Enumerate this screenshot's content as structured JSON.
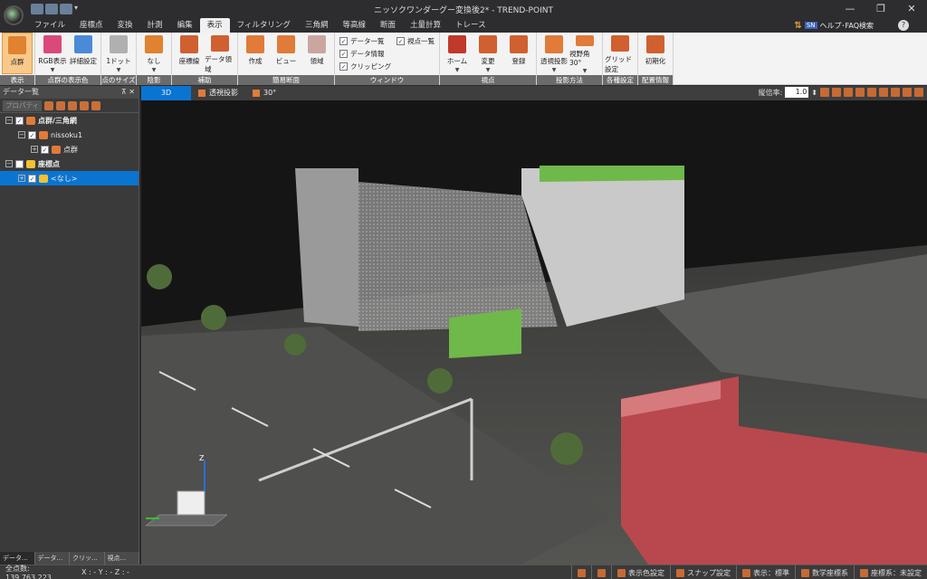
{
  "window": {
    "title": "ニッソクワンダーグー変換後2* - TREND-POINT",
    "minimize": "—",
    "maximize": "❐",
    "close": "✕"
  },
  "menu": {
    "tabs": [
      "ファイル",
      "座標点",
      "変換",
      "計測",
      "編集",
      "表示",
      "フィルタリング",
      "三角網",
      "等高線",
      "断面",
      "土量計算",
      "トレース"
    ],
    "active_index": 5,
    "help_label": "ヘルプ･FAQ検索",
    "help_badge": "SN",
    "help_q": "?"
  },
  "ribbon": {
    "groups": [
      {
        "label": "表示",
        "buttons": [
          {
            "label": "点群",
            "icon_color": "#e0822f",
            "selected": true
          }
        ]
      },
      {
        "label": "点群の表示色",
        "buttons": [
          {
            "label": "RGB表示",
            "icon_color": "#d94a7a",
            "arrow": true
          },
          {
            "label": "詳細設定",
            "icon_color": "#4a8ad6"
          }
        ]
      },
      {
        "label": "点のサイズ",
        "buttons": [
          {
            "label": "1ドット",
            "icon_color": "#b0b0b0",
            "arrow": true
          }
        ]
      },
      {
        "label": "陰影",
        "buttons": [
          {
            "label": "なし",
            "icon_color": "#e0822f",
            "arrow": true
          }
        ]
      },
      {
        "label": "補助",
        "buttons": [
          {
            "label": "座標線",
            "icon_color": "#d06030"
          },
          {
            "label": "データ領域",
            "icon_color": "#d06030"
          }
        ]
      },
      {
        "label": "簡易断面",
        "buttons": [
          {
            "label": "作成",
            "icon_color": "#e07b39"
          },
          {
            "label": "ビュー",
            "icon_color": "#e07b39"
          },
          {
            "label": "領域",
            "icon_color": "#c9a7a0"
          }
        ]
      },
      {
        "label": "ウィンドウ",
        "checks": [
          "データ一覧",
          "データ情報",
          "クリッピング"
        ],
        "checks2": [
          "視点一覧"
        ]
      },
      {
        "label": "視点",
        "buttons": [
          {
            "label": "ホーム",
            "icon_color": "#c0392b",
            "arrow": true
          },
          {
            "label": "変更",
            "icon_color": "#d06030",
            "arrow": true
          },
          {
            "label": "登録",
            "icon_color": "#d06030"
          }
        ]
      },
      {
        "label": "投影方法",
        "buttons": [
          {
            "label": "透視投影",
            "icon_color": "#e07b39",
            "arrow": true
          },
          {
            "label": "視野角30°",
            "icon_color": "#e07b39",
            "arrow": true
          }
        ]
      },
      {
        "label": "各種設定",
        "buttons": [
          {
            "label": "グリッド設定",
            "icon_color": "#d06030"
          }
        ]
      },
      {
        "label": "配置情報",
        "buttons": [
          {
            "label": "初期化",
            "icon_color": "#d06030"
          }
        ]
      }
    ]
  },
  "left_panel": {
    "title": "データ一覧",
    "pin": "⊼ ✕",
    "property_label": "プロパティ",
    "tree": [
      {
        "label": "点群/三角網",
        "level": 0,
        "icon_color": "#e07b39",
        "bold": true
      },
      {
        "label": "nissoku1",
        "level": 1,
        "icon_color": "#e07b39"
      },
      {
        "label": "点群",
        "level": 2,
        "icon_color": "#e07b39"
      },
      {
        "label": "座標点",
        "level": 0,
        "icon_color": "#f2c230",
        "bold": true
      },
      {
        "label": "<なし>",
        "level": 1,
        "icon_color": "#f2c230",
        "selected": true
      }
    ],
    "tabs": [
      "データ...",
      "データ...",
      "クリッ...",
      "視点..."
    ]
  },
  "viewport_tabs": {
    "tabs": [
      "3D",
      "透視投影",
      "30°"
    ],
    "zoom_label": "縦倍率:",
    "zoom_value": "1.0"
  },
  "status": {
    "point_count": "全点数: 139,763,223",
    "coords": "X : -  Y : -  Z : -",
    "right_items": [
      "表示色設定",
      "スナップ設定",
      "表示：標準",
      "数学座標系",
      "座標系：未設定"
    ]
  }
}
